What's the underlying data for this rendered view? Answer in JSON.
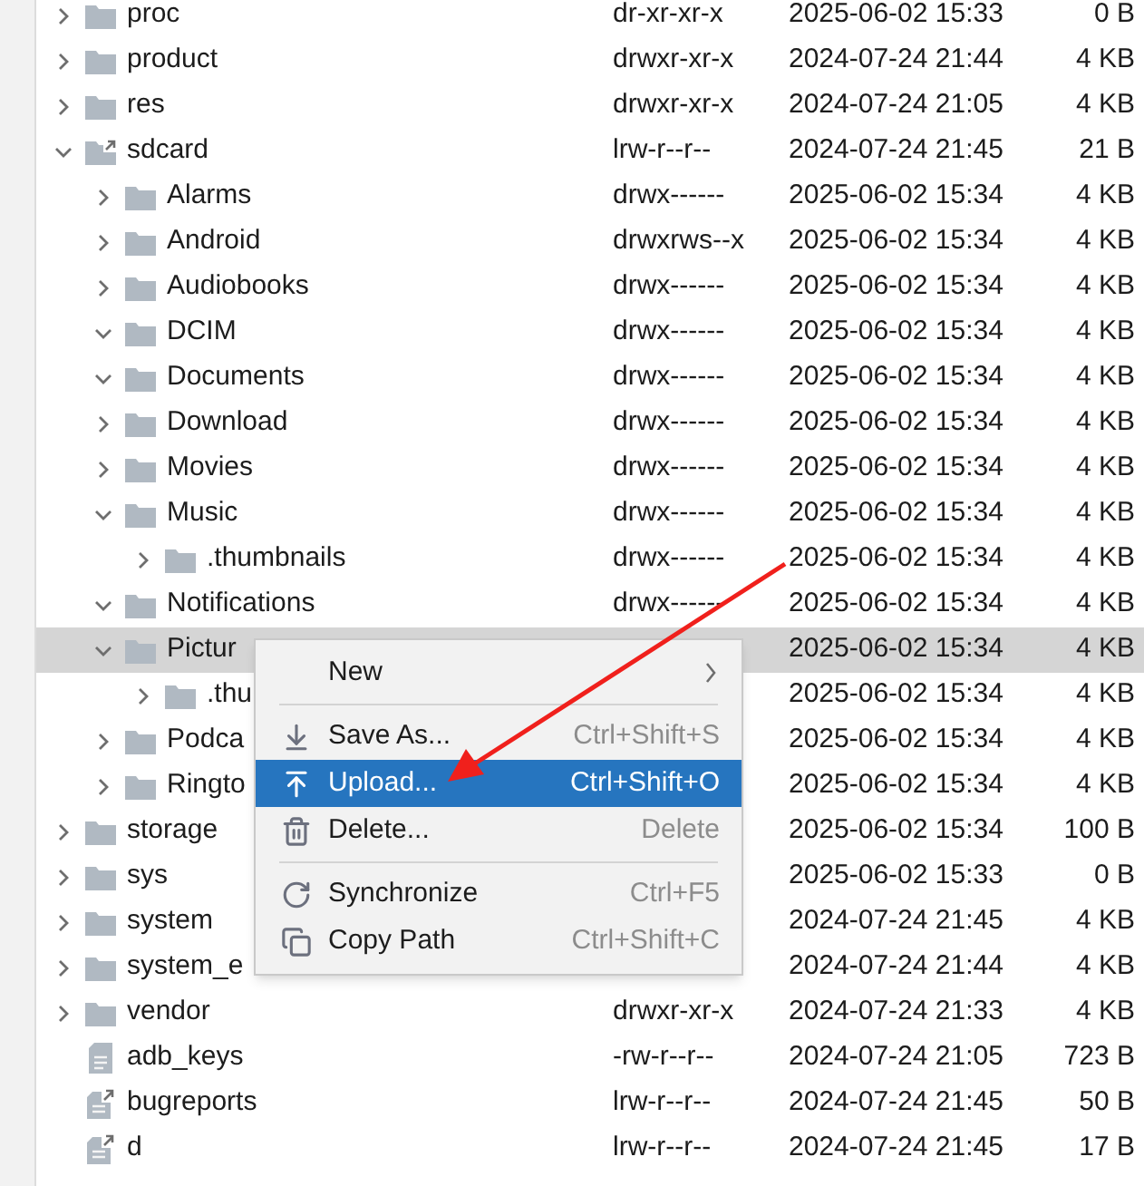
{
  "rows": [
    {
      "name": "proc",
      "kind": "folder",
      "expanded": false,
      "perm": "dr-xr-xr-x",
      "date": "2025-06-02 15:33",
      "size": "0 B"
    },
    {
      "name": "product",
      "kind": "folder",
      "expanded": false,
      "perm": "drwxr-xr-x",
      "date": "2024-07-24 21:44",
      "size": "4 KB"
    },
    {
      "name": "res",
      "kind": "folder",
      "expanded": false,
      "perm": "drwxr-xr-x",
      "date": "2024-07-24 21:05",
      "size": "4 KB"
    },
    {
      "name": "sdcard",
      "kind": "folder-link",
      "expanded": true,
      "perm": "lrw-r--r--",
      "date": "2024-07-24 21:45",
      "size": "21 B",
      "children": [
        {
          "name": "Alarms",
          "kind": "folder",
          "expanded": false,
          "perm": "drwx------",
          "date": "2025-06-02 15:34",
          "size": "4 KB"
        },
        {
          "name": "Android",
          "kind": "folder",
          "expanded": false,
          "perm": "drwxrws--x",
          "date": "2025-06-02 15:34",
          "size": "4 KB"
        },
        {
          "name": "Audiobooks",
          "kind": "folder",
          "expanded": false,
          "perm": "drwx------",
          "date": "2025-06-02 15:34",
          "size": "4 KB"
        },
        {
          "name": "DCIM",
          "kind": "folder",
          "expanded": true,
          "perm": "drwx------",
          "date": "2025-06-02 15:34",
          "size": "4 KB"
        },
        {
          "name": "Documents",
          "kind": "folder",
          "expanded": true,
          "perm": "drwx------",
          "date": "2025-06-02 15:34",
          "size": "4 KB"
        },
        {
          "name": "Download",
          "kind": "folder",
          "expanded": false,
          "perm": "drwx------",
          "date": "2025-06-02 15:34",
          "size": "4 KB"
        },
        {
          "name": "Movies",
          "kind": "folder",
          "expanded": false,
          "perm": "drwx------",
          "date": "2025-06-02 15:34",
          "size": "4 KB"
        },
        {
          "name": "Music",
          "kind": "folder",
          "expanded": true,
          "perm": "drwx------",
          "date": "2025-06-02 15:34",
          "size": "4 KB",
          "children": [
            {
              "name": ".thumbnails",
              "kind": "folder",
              "expanded": false,
              "perm": "drwx------",
              "date": "2025-06-02 15:34",
              "size": "4 KB"
            }
          ]
        },
        {
          "name": "Notifications",
          "kind": "folder",
          "expanded": true,
          "perm": "drwx------",
          "date": "2025-06-02 15:34",
          "size": "4 KB"
        },
        {
          "name": "Pictur",
          "kind": "folder",
          "expanded": true,
          "selected": true,
          "date": "2025-06-02 15:34",
          "size": "4 KB",
          "children": [
            {
              "name": ".thu",
              "kind": "folder",
              "expanded": false,
              "date": "2025-06-02 15:34",
              "size": "4 KB"
            }
          ]
        },
        {
          "name": "Podca",
          "kind": "folder",
          "expanded": false,
          "date": "2025-06-02 15:34",
          "size": "4 KB"
        },
        {
          "name": "Ringto",
          "kind": "folder",
          "expanded": false,
          "date": "2025-06-02 15:34",
          "size": "4 KB"
        }
      ]
    },
    {
      "name": "storage",
      "kind": "folder",
      "expanded": false,
      "date": "2025-06-02 15:34",
      "size": "100 B"
    },
    {
      "name": "sys",
      "kind": "folder",
      "expanded": false,
      "date": "2025-06-02 15:33",
      "size": "0 B"
    },
    {
      "name": "system",
      "kind": "folder",
      "expanded": false,
      "date": "2024-07-24 21:45",
      "size": "4 KB"
    },
    {
      "name": "system_e",
      "kind": "folder",
      "expanded": false,
      "date": "2024-07-24 21:44",
      "size": "4 KB"
    },
    {
      "name": "vendor",
      "kind": "folder",
      "expanded": false,
      "perm": "drwxr-xr-x",
      "date": "2024-07-24 21:33",
      "size": "4 KB"
    },
    {
      "name": "adb_keys",
      "kind": "file",
      "perm": "-rw-r--r--",
      "date": "2024-07-24 21:05",
      "size": "723 B"
    },
    {
      "name": "bugreports",
      "kind": "file-link",
      "perm": "lrw-r--r--",
      "date": "2024-07-24 21:45",
      "size": "50 B"
    },
    {
      "name": "d",
      "kind": "file-link",
      "perm": "lrw-r--r--",
      "date": "2024-07-24 21:45",
      "size": "17 B"
    }
  ],
  "context_menu": [
    {
      "kind": "submenu",
      "label": "New",
      "selected": false
    },
    {
      "kind": "separator"
    },
    {
      "kind": "item",
      "label": "Save As...",
      "shortcut": "Ctrl+Shift+S",
      "selected": false
    },
    {
      "kind": "item",
      "label": "Upload...",
      "shortcut": "Ctrl+Shift+O",
      "selected": true
    },
    {
      "kind": "item",
      "label": "Delete...",
      "shortcut": "Delete",
      "selected": false
    },
    {
      "kind": "separator"
    },
    {
      "kind": "item",
      "label": "Synchronize",
      "shortcut": "Ctrl+F5",
      "selected": false
    },
    {
      "kind": "item",
      "label": "Copy Path",
      "shortcut": "Ctrl+Shift+C",
      "selected": false
    }
  ]
}
